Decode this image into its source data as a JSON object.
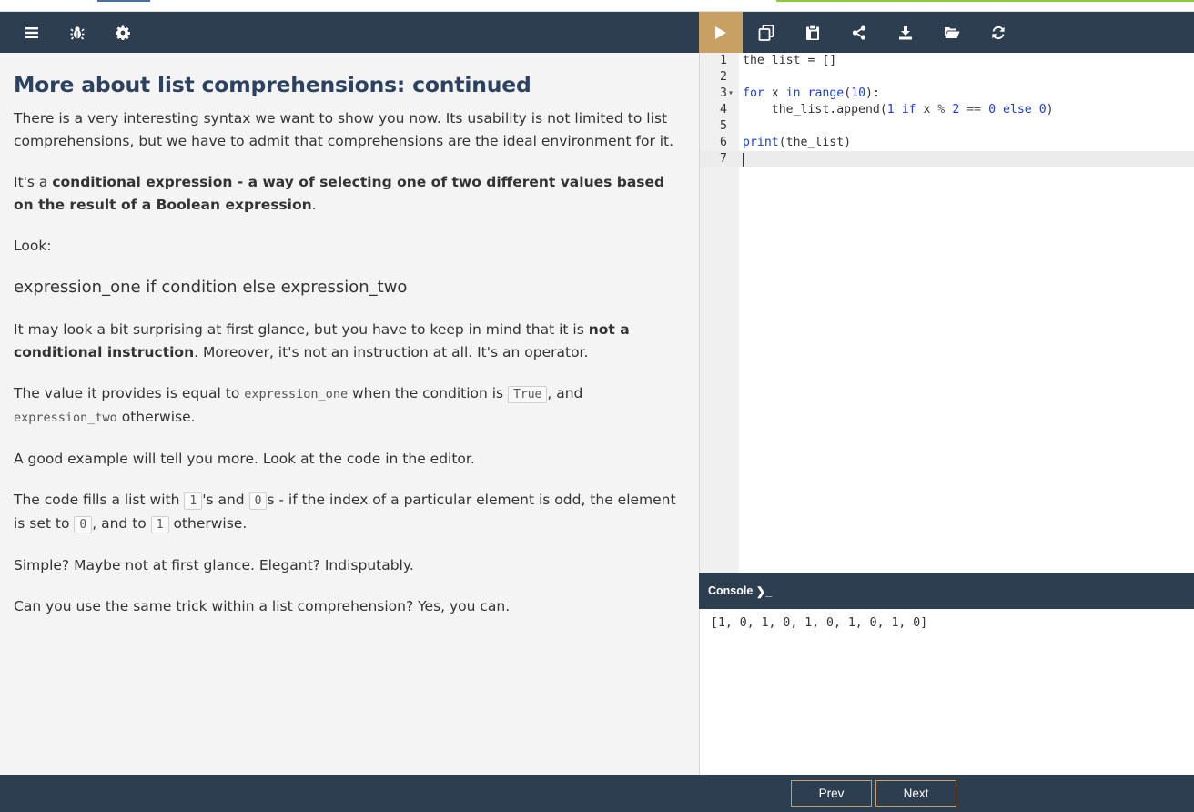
{
  "theme": {
    "toolbar_bg": "#2d3e50",
    "run_button_bg": "#c9a063",
    "heading_color": "#2c4260",
    "keyword_color": "#1c3fd1"
  },
  "left_toolbar": {
    "icons": [
      "menu-icon",
      "bug-icon",
      "gear-icon"
    ]
  },
  "right_toolbar": {
    "icons": [
      "play-icon",
      "copy-icon",
      "paste-icon",
      "share-icon",
      "download-icon",
      "folder-open-icon",
      "refresh-icon"
    ]
  },
  "lesson": {
    "title": "More about list comprehensions: continued",
    "p1": "There is a very interesting syntax we want to show you now. Its usability is not limited to list comprehensions, but we have to admit that comprehensions are the ideal environment for it.",
    "p2_prefix": "It's a ",
    "p2_bold": "conditional expression - a way of selecting one of two different values based on the result of a Boolean expression",
    "p2_suffix": ".",
    "p3": "Look:",
    "p4": "expression_one if condition else expression_two",
    "p5_prefix": "It may look a bit surprising at first glance, but you have to keep in mind that it is ",
    "p5_bold": "not a conditional instruction",
    "p5_suffix": ". Moreover, it's not an instruction at all. It's an operator.",
    "p6_a": "The value it provides is equal to ",
    "p6_code1": "expression_one",
    "p6_b": " when the condition is ",
    "p6_code2": "True",
    "p6_c": ", and ",
    "p6_code3": "expression_two",
    "p6_d": " otherwise.",
    "p7": "A good example will tell you more. Look at the code in the editor.",
    "p8_a": "The code fills a list with ",
    "p8_code1": "1",
    "p8_b": "'s and ",
    "p8_code2": "0",
    "p8_c": "s - if the index of a particular element is odd, the element is set to ",
    "p8_code3": "0",
    "p8_d": ", and to ",
    "p8_code4": "1",
    "p8_e": " otherwise.",
    "p9": "Simple? Maybe not at first glance. Elegant? Indisputably.",
    "p10": "Can you use the same trick within a list comprehension? Yes, you can."
  },
  "editor": {
    "line_numbers": [
      "1",
      "2",
      "3",
      "4",
      "5",
      "6",
      "7"
    ],
    "lines": [
      "the_list = []",
      "",
      "for x in range(10):",
      "    the_list.append(1 if x % 2 == 0 else 0)",
      "",
      "print(the_list)",
      ""
    ],
    "tokens": {
      "for": "for",
      "in": "in",
      "range": "range",
      "ten": "10",
      "one": "1",
      "if": "if",
      "two": "2",
      "zero": "0",
      "else": "else",
      "print": "print"
    }
  },
  "console": {
    "label": "Console",
    "prompt_symbol": "❯_",
    "output": "[1, 0, 1, 0, 1, 0, 1, 0, 1, 0]"
  },
  "nav": {
    "prev_label": "Prev",
    "next_label": "Next"
  }
}
